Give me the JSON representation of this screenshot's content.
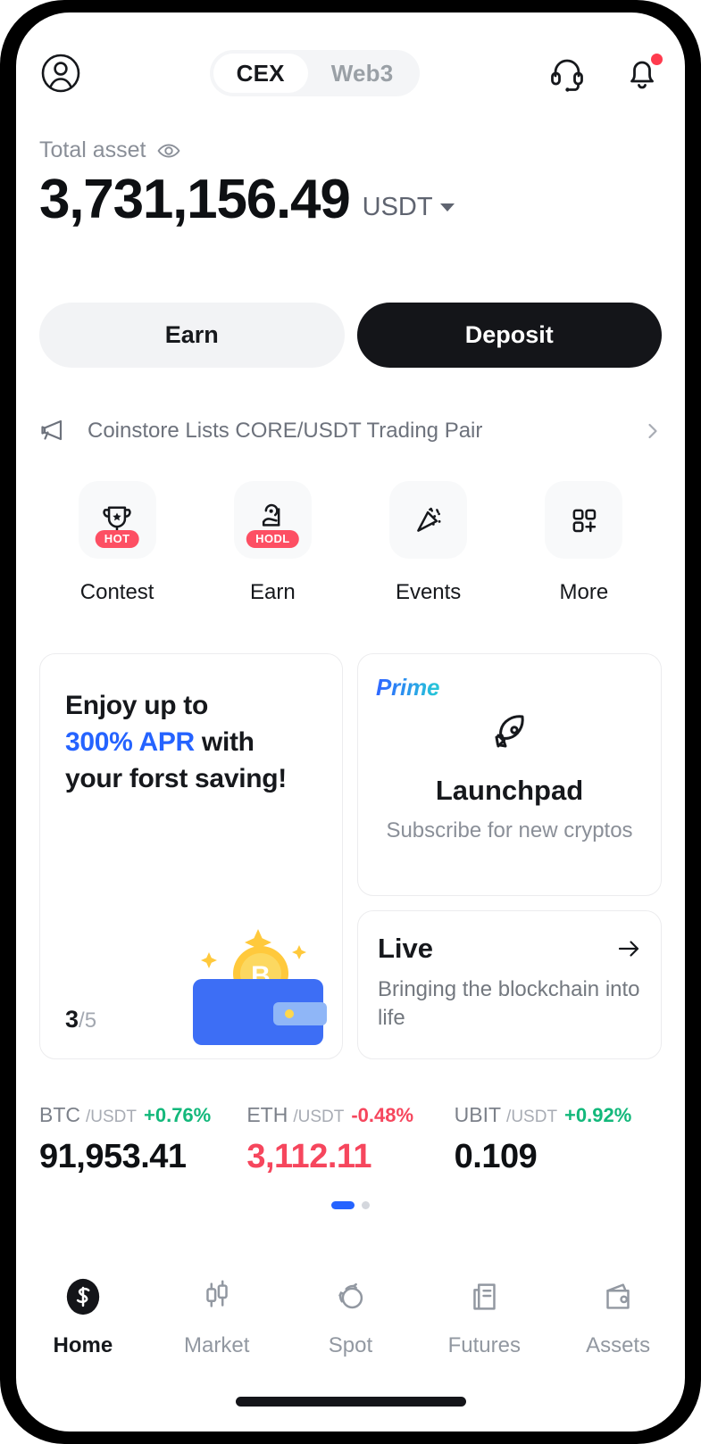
{
  "header": {
    "avatar_icon": "user-circle-icon",
    "tabs": [
      {
        "label": "CEX",
        "active": true
      },
      {
        "label": "Web3",
        "active": false
      }
    ],
    "support_icon": "headset-icon",
    "notification_icon": "bell-icon",
    "notification_has_badge": true
  },
  "balance": {
    "label": "Total asset",
    "visibility_icon": "eye-icon",
    "amount": "3,731,156.49",
    "currency": "USDT",
    "currency_caret_icon": "caret-down-icon"
  },
  "actions": {
    "earn_label": "Earn",
    "deposit_label": "Deposit"
  },
  "announcement": {
    "icon": "megaphone-icon",
    "text": "Coinstore Lists CORE/USDT Trading Pair",
    "chevron_icon": "chevron-right-icon"
  },
  "quick_actions": [
    {
      "label": "Contest",
      "icon": "trophy-icon",
      "badge": "HOT"
    },
    {
      "label": "Earn",
      "icon": "piggy-hand-icon",
      "badge": "HODL"
    },
    {
      "label": "Events",
      "icon": "confetti-icon",
      "badge": ""
    },
    {
      "label": "More",
      "icon": "grid-plus-icon",
      "badge": ""
    }
  ],
  "promo_left": {
    "line1": "Enjoy up to",
    "highlight": "300% APR",
    "line2_rest": " with",
    "line3": "your forst saving!",
    "page_current": "3",
    "page_total": "/5",
    "art_icon": "wallet-bitcoin-illustration"
  },
  "launchpad": {
    "tag": "Prime",
    "icon": "rocket-icon",
    "title": "Launchpad",
    "subtitle": "Subscribe for new cryptos"
  },
  "live": {
    "title": "Live",
    "arrow_icon": "arrow-right-icon",
    "subtitle": "Bringing the blockchain into life"
  },
  "tickers": [
    {
      "base": "BTC",
      "quote": "/USDT",
      "change": "+0.76%",
      "direction": "up",
      "price": "91,953.41",
      "price_style": "neutral"
    },
    {
      "base": "ETH",
      "quote": "/USDT",
      "change": "-0.48%",
      "direction": "down",
      "price": "3,112.11",
      "price_style": "down"
    },
    {
      "base": "UBIT",
      "quote": "/USDT",
      "change": "+0.92%",
      "direction": "up",
      "price": "0.109",
      "price_style": "neutral"
    }
  ],
  "carousel_dots": {
    "count": 2,
    "active_index": 0
  },
  "bottom_nav": [
    {
      "label": "Home",
      "icon": "coinstore-logo-icon",
      "active": true
    },
    {
      "label": "Market",
      "icon": "candlestick-icon",
      "active": false
    },
    {
      "label": "Spot",
      "icon": "swap-circles-icon",
      "active": false
    },
    {
      "label": "Futures",
      "icon": "futures-document-icon",
      "active": false
    },
    {
      "label": "Assets",
      "icon": "wallet-icon",
      "active": false
    }
  ],
  "colors": {
    "accent_blue": "#2563ff",
    "up_green": "#13b87b",
    "down_red": "#f6465d",
    "badge_red": "#fd4f63",
    "dark": "#141519"
  }
}
